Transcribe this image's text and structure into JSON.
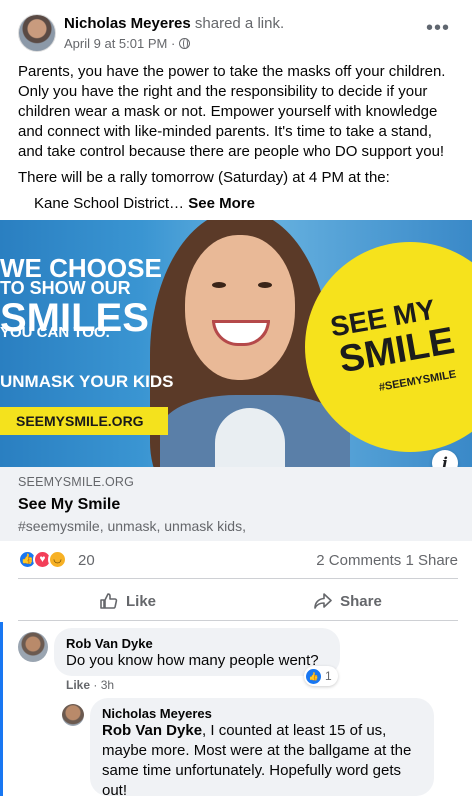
{
  "post": {
    "author": "Nicholas Meyeres",
    "action": " shared a link.",
    "date": "April 9 at 5:01 PM ·",
    "more_icon": "more-horizontal-icon",
    "paragraph1": "Parents, you have the power to take the masks off your children. Only you have the right and the responsibility to decide if your children wear a mask or not. Empower yourself with knowledge and connect with like-minded parents. It's time to take a stand, and take control because there are people who DO support you!",
    "paragraph2": "There will be a rally tomorrow (Saturday) at 4 PM at the:",
    "paragraph3": "Kane School District…",
    "see_more": "See More"
  },
  "link_image": {
    "line1": "WE CHOOSE",
    "line2": "TO SHOW OUR",
    "line3": "SMILES",
    "line4": "YOU CAN TOO.",
    "line5": "UNMASK YOUR KIDS",
    "url_banner": "SEEMYSMILE.ORG",
    "sticker_line1": "SEE MY",
    "sticker_line2": "SMILE",
    "sticker_hashtag": "#SEEMYSMILE",
    "info_label": "i"
  },
  "link_meta": {
    "domain": "SEEMYSMILE.ORG",
    "title": "See My Smile",
    "description": "#seemysmile, unmask, unmask kids,"
  },
  "stats": {
    "reaction_count": "20",
    "comments_shares": "2 Comments  1 Share",
    "reactions": [
      "like",
      "love",
      "haha"
    ]
  },
  "actions": {
    "like_label": "Like",
    "share_label": "Share"
  },
  "comments": [
    {
      "author": "Rob Van Dyke",
      "text": "Do you know how many people went?",
      "like_label": "Like",
      "time": "· 3h",
      "reaction_count": "1"
    },
    {
      "author": "Nicholas Meyeres",
      "mention": "Rob Van Dyke",
      "text": ", I counted at least 15 of us, maybe more. Most were at the ballgame at the same time unfortunately. Hopefully word gets out!"
    }
  ],
  "colors": {
    "accent": "#1877f2",
    "banner_yellow": "#f4e21d",
    "link_meta_bg": "#f0f2f5"
  }
}
